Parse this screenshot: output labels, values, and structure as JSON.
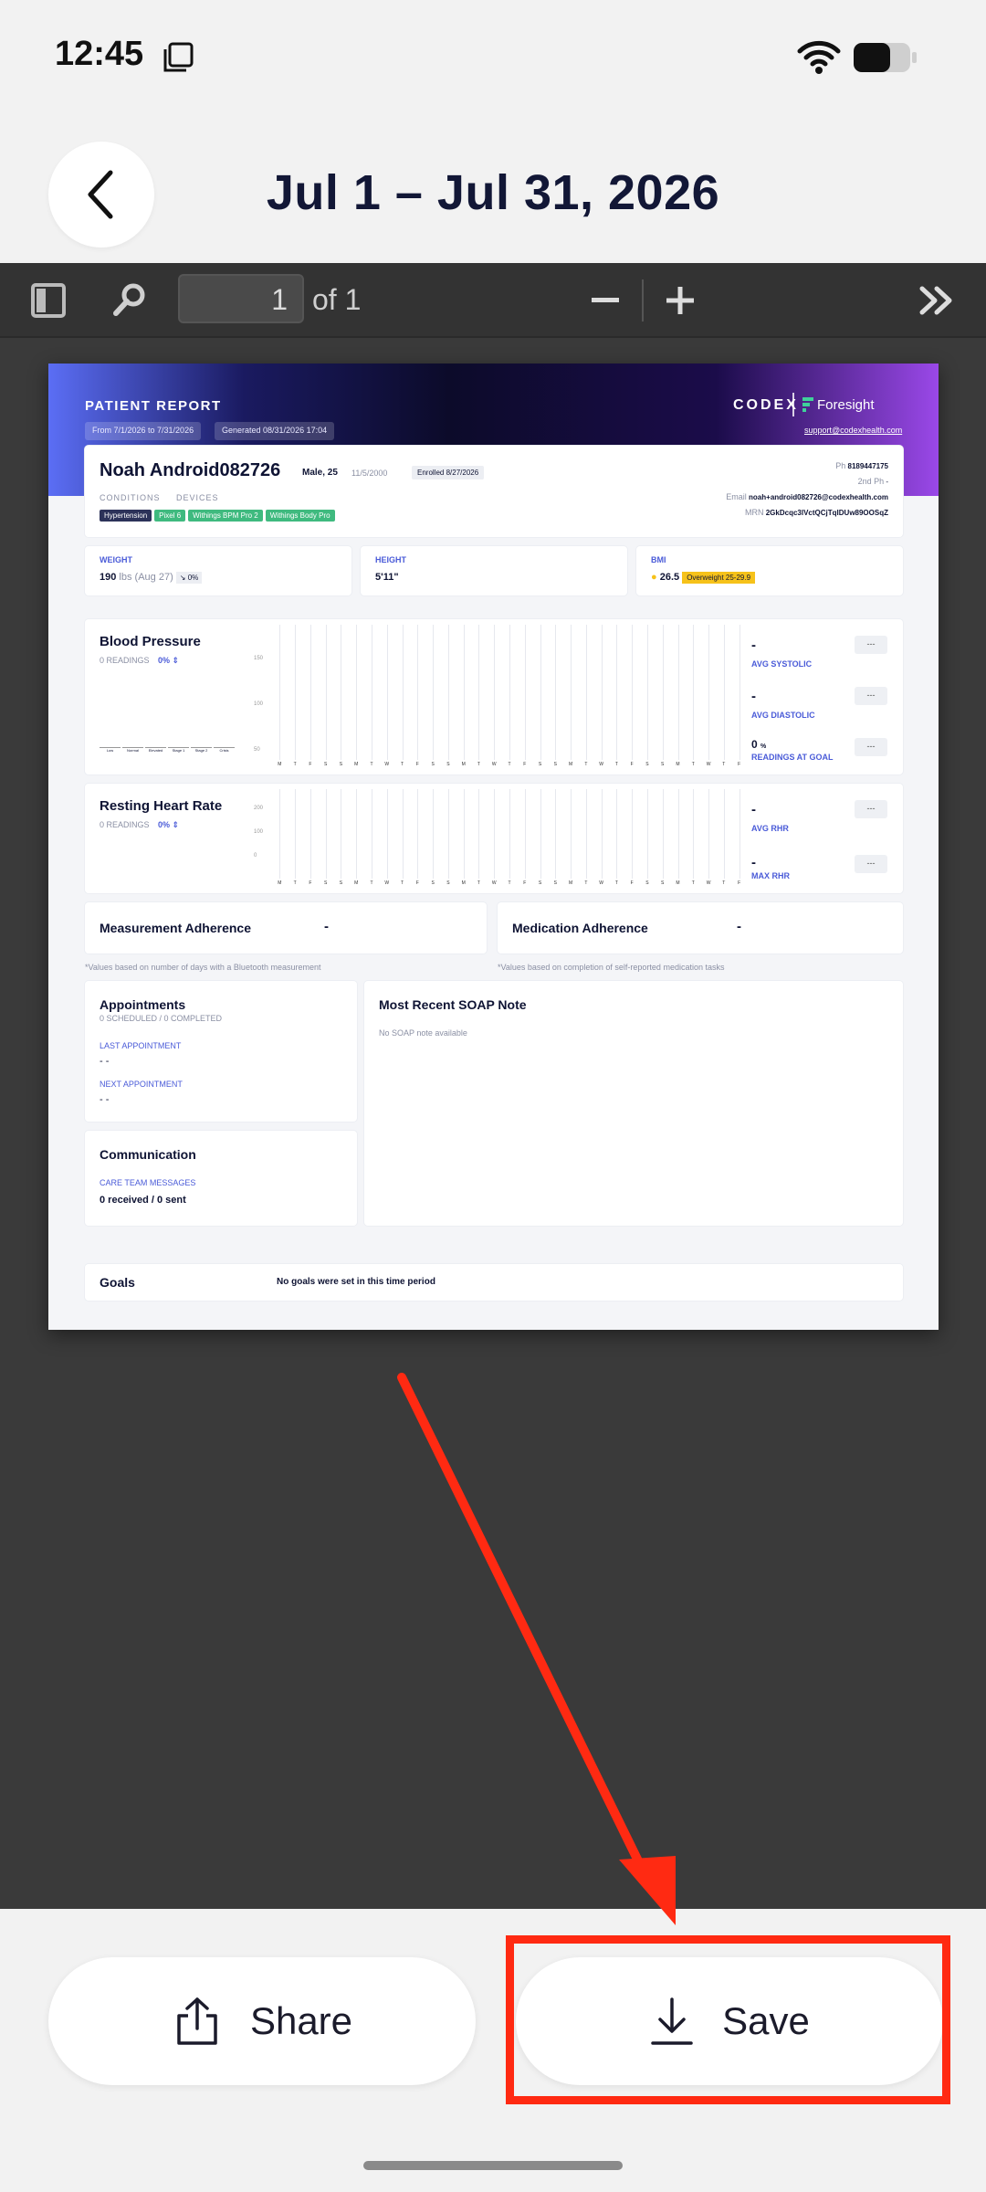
{
  "status_bar": {
    "time": "12:45"
  },
  "header": {
    "title": "Jul 1 – Jul 31, 2026"
  },
  "viewer_toolbar": {
    "page_value": "1",
    "page_of": "of 1"
  },
  "report": {
    "title": "PATIENT REPORT",
    "date_range": "From 7/1/2026 to 7/31/2026",
    "generated": "Generated 08/31/2026 17:04",
    "brand_codex": "CODEX",
    "brand_foresight": "Foresight",
    "support_email": "support@codexhealth.com",
    "patient": {
      "name": "Noah Android082726",
      "sex_age": "Male, 25",
      "dob": "11/5/2000",
      "enrolled": "Enrolled 8/27/2026",
      "conditions_label": "CONDITIONS",
      "devices_label": "DEVICES",
      "conditions": [
        "Hypertension"
      ],
      "devices": [
        "Pixel 6",
        "Withings BPM Pro 2",
        "Withings Body Pro"
      ],
      "ph_label": "Ph",
      "phone": "8189447175",
      "ph2_label": "2nd Ph",
      "phone2": "-",
      "email_label": "Email",
      "email": "noah+android082726@codexhealth.com",
      "mrn_label": "MRN",
      "mrn": "2GkDcqc3lVctQCjTqIDUw89OOSqZ"
    },
    "vitals": {
      "weight_label": "WEIGHT",
      "weight_value": "190",
      "weight_unit": "lbs (Aug 27)",
      "weight_change": "↘ 0%",
      "height_label": "HEIGHT",
      "height_value": "5'11\"",
      "bmi_label": "BMI",
      "bmi_value": "26.5",
      "bmi_badge": "Overweight 25-29.9"
    },
    "blood_pressure": {
      "title": "Blood Pressure",
      "readings": "0 READINGS",
      "pct": "0% ⇕",
      "y_ticks": [
        "150",
        "100",
        "50"
      ],
      "categories": [
        "Low",
        "Normal",
        "Elevated",
        "Stage 1",
        "Stage 2",
        "Crisis"
      ],
      "avg_sys_label": "AVG SYSTOLIC",
      "avg_sys": "-",
      "avg_dia_label": "AVG DIASTOLIC",
      "avg_dia": "-",
      "goal_label": "READINGS AT GOAL",
      "goal_value": "0",
      "goal_unit": "%",
      "pill": "---"
    },
    "heart_rate": {
      "title": "Resting Heart Rate",
      "readings": "0 READINGS",
      "pct": "0% ⇕",
      "y_ticks": [
        "200",
        "100",
        "0"
      ],
      "avg_label": "AVG RHR",
      "avg": "-",
      "max_label": "MAX RHR",
      "max": "-",
      "pill": "---"
    },
    "days": [
      "M",
      "T",
      "F",
      "S",
      "S",
      "M",
      "T",
      "W",
      "T",
      "F",
      "S",
      "S",
      "M",
      "T",
      "W",
      "T",
      "F",
      "S",
      "S",
      "M",
      "T",
      "W",
      "T",
      "F",
      "S",
      "S",
      "M",
      "T",
      "W",
      "T",
      "F"
    ],
    "measurement_adherence": {
      "title": "Measurement Adherence",
      "value": "-",
      "note": "*Values based on number of days with a Bluetooth measurement"
    },
    "medication_adherence": {
      "title": "Medication Adherence",
      "value": "-",
      "note": "*Values based on completion of self-reported medication tasks"
    },
    "appointments": {
      "title": "Appointments",
      "summary": "0 SCHEDULED / 0 COMPLETED",
      "last_label": "LAST APPOINTMENT",
      "last_value": "- -",
      "next_label": "NEXT APPOINTMENT",
      "next_value": "- -"
    },
    "soap": {
      "title": "Most Recent SOAP Note",
      "empty": "No SOAP note available"
    },
    "communication": {
      "title": "Communication",
      "label": "CARE TEAM MESSAGES",
      "value": "0 received / 0 sent"
    },
    "goals": {
      "title": "Goals",
      "empty": "No goals were set in this time period"
    }
  },
  "actions": {
    "share_label": "Share",
    "save_label": "Save"
  },
  "colors": {
    "highlight": "#ff2a12",
    "accent_blue": "#4a5bd8"
  }
}
